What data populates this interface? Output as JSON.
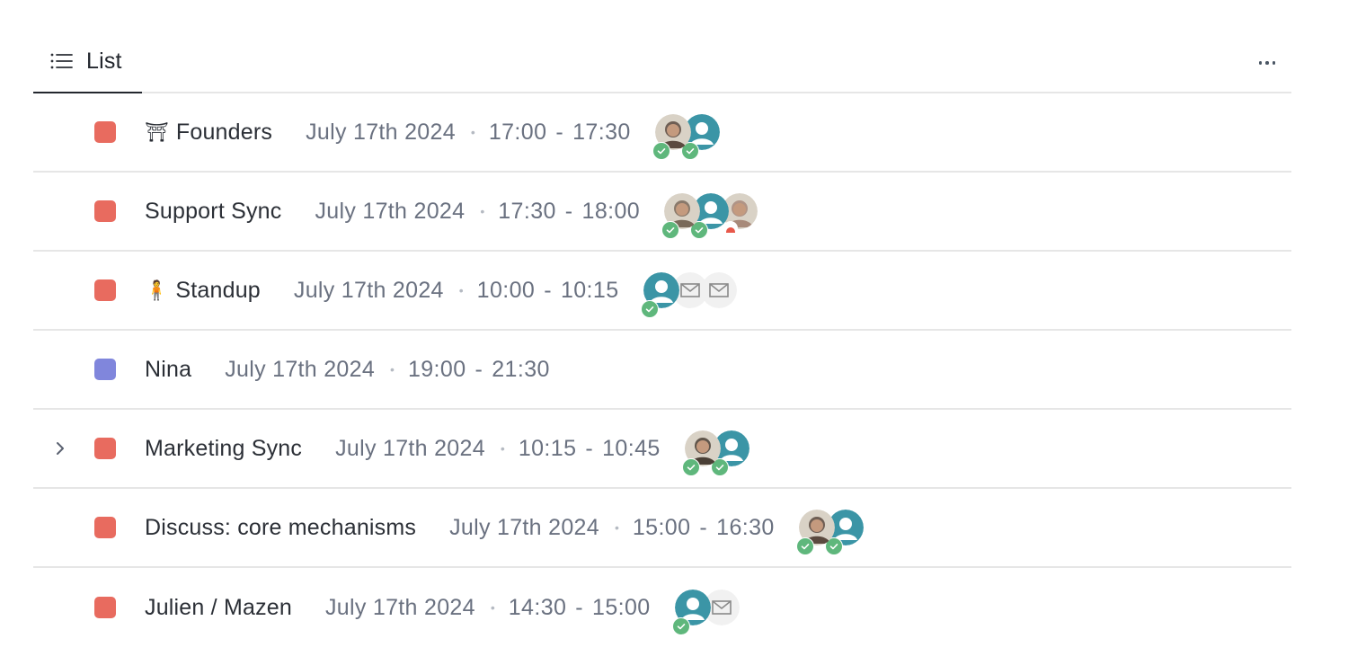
{
  "view": {
    "tab_label": "List",
    "tab_icon": "list-icon",
    "more_icon": "more-horizontal-icon"
  },
  "colors": {
    "event_red": "#e86b5f",
    "event_purple": "#8086dc",
    "accepted_green": "#5fb77c",
    "avatar_teal": "#3b95a6",
    "invite_grey": "#f1f1f1"
  },
  "events": [
    {
      "title": "Founders",
      "emoji": "⛩",
      "color": "#e86b5f",
      "expandable": false,
      "date": "July 17th 2024",
      "start": "17:00",
      "end": "17:30",
      "attendees": [
        {
          "type": "photo",
          "tone": "#5b4a3f",
          "status": "accepted"
        },
        {
          "type": "placeholder",
          "status": "accepted"
        }
      ]
    },
    {
      "title": "Support Sync",
      "emoji": "",
      "color": "#e86b5f",
      "expandable": false,
      "date": "July 17th 2024",
      "start": "17:30",
      "end": "18:00",
      "attendees": [
        {
          "type": "photo",
          "tone": "#7a6a5a",
          "status": "accepted"
        },
        {
          "type": "placeholder",
          "status": "accepted"
        },
        {
          "type": "photo",
          "tone": "#a88a7a",
          "status": "declined"
        }
      ]
    },
    {
      "title": "Standup",
      "emoji": "🧍",
      "color": "#e86b5f",
      "expandable": false,
      "date": "July 17th 2024",
      "start": "10:00",
      "end": "10:15",
      "attendees": [
        {
          "type": "placeholder",
          "status": "accepted"
        },
        {
          "type": "invite",
          "status": "none"
        },
        {
          "type": "invite",
          "status": "none"
        }
      ]
    },
    {
      "title": "Nina",
      "emoji": "",
      "color": "#8086dc",
      "expandable": false,
      "date": "July 17th 2024",
      "start": "19:00",
      "end": "21:30",
      "attendees": []
    },
    {
      "title": "Marketing Sync",
      "emoji": "",
      "color": "#e86b5f",
      "expandable": true,
      "date": "July 17th 2024",
      "start": "10:15",
      "end": "10:45",
      "attendees": [
        {
          "type": "photo",
          "tone": "#4a3f35",
          "status": "accepted"
        },
        {
          "type": "placeholder",
          "status": "accepted"
        }
      ]
    },
    {
      "title": "Discuss: core mechanisms",
      "emoji": "",
      "color": "#e86b5f",
      "expandable": false,
      "date": "July 17th 2024",
      "start": "15:00",
      "end": "16:30",
      "attendees": [
        {
          "type": "photo",
          "tone": "#5b4a3f",
          "status": "accepted"
        },
        {
          "type": "placeholder",
          "status": "accepted"
        }
      ]
    },
    {
      "title": "Julien / Mazen",
      "emoji": "",
      "color": "#e86b5f",
      "expandable": false,
      "date": "July 17th 2024",
      "start": "14:30",
      "end": "15:00",
      "attendees": [
        {
          "type": "placeholder",
          "status": "accepted"
        },
        {
          "type": "invite",
          "status": "none"
        }
      ]
    }
  ]
}
